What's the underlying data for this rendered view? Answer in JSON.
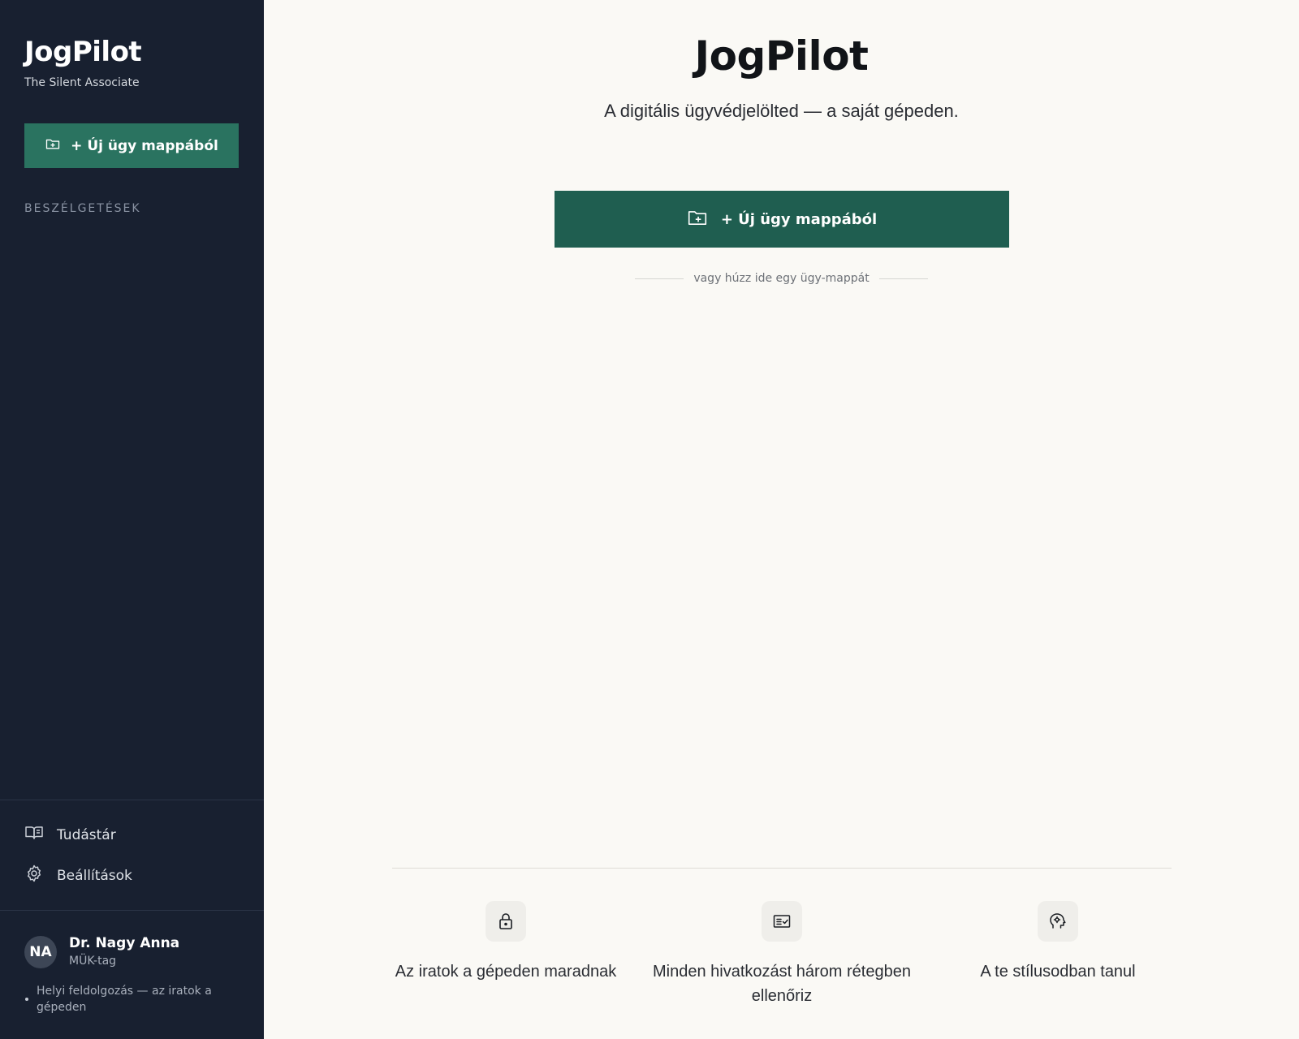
{
  "sidebar": {
    "brand": "JogPilot",
    "tagline": "The Silent Associate",
    "new_case_label": "+ Új ügy mappából",
    "section_label": "BESZÉLGETÉSEK",
    "nav": [
      {
        "label": "Tudástár",
        "icon": "book-icon"
      },
      {
        "label": "Beállítások",
        "icon": "gear-icon"
      }
    ],
    "user": {
      "initials": "NA",
      "name": "Dr. Nagy Anna",
      "role": "MÜK-tag"
    },
    "status": "Helyi feldolgozás — az iratok a gépeden"
  },
  "main": {
    "title": "JogPilot",
    "subtitle": "A digitális ügyvédjelölted — a saját gépeden.",
    "new_case_label": "+ Új ügy mappából",
    "drop_hint": "vagy húzz ide egy ügy-mappát",
    "features": [
      {
        "icon": "lock-icon",
        "text": "Az iratok a gépeden maradnak"
      },
      {
        "icon": "checklist-icon",
        "text": "Minden hivatkozást három rétegben ellenőriz"
      },
      {
        "icon": "brain-gear-icon",
        "text": "A te stílusodban tanul"
      }
    ]
  },
  "colors": {
    "sidebar_bg": "#182030",
    "accent_green": "#1f5e50",
    "sidebar_button_green": "#2a7360",
    "main_bg": "#faf9f5"
  }
}
